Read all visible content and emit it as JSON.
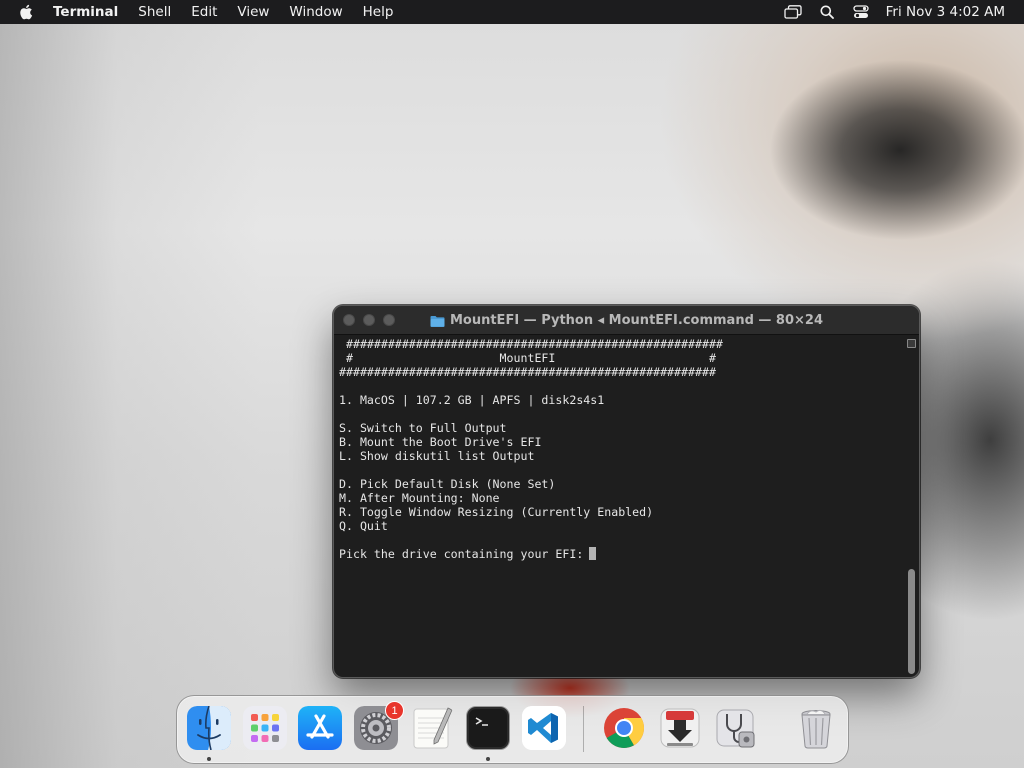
{
  "menubar": {
    "app_name": "Terminal",
    "items": [
      "Shell",
      "Edit",
      "View",
      "Window",
      "Help"
    ],
    "clock": "Fri Nov 3  4:02 AM",
    "status_icons": [
      "screen-mirroring-icon",
      "search-icon",
      "control-center-icon"
    ]
  },
  "terminal": {
    "title": "MountEFI — Python ◂ MountEFI.command — 80×24",
    "lines": [
      " ######################################################",
      " #                     MountEFI                      #",
      "######################################################",
      "",
      "1. MacOS | 107.2 GB | APFS | disk2s4s1",
      "",
      "S. Switch to Full Output",
      "B. Mount the Boot Drive's EFI",
      "L. Show diskutil list Output",
      "",
      "D. Pick Default Disk (None Set)",
      "M. After Mounting: None",
      "R. Toggle Window Resizing (Currently Enabled)",
      "Q. Quit",
      ""
    ],
    "prompt": "Pick the drive containing your EFI:"
  },
  "dock": {
    "apps": [
      {
        "name": "finder",
        "running": true
      },
      {
        "name": "launchpad",
        "running": false
      },
      {
        "name": "app-store",
        "running": false
      },
      {
        "name": "system-settings",
        "running": false,
        "badge": "1"
      },
      {
        "name": "textedit",
        "running": false
      },
      {
        "name": "terminal",
        "running": true
      },
      {
        "name": "visual-studio-code",
        "running": false
      },
      {
        "name": "google-chrome",
        "running": false
      },
      {
        "name": "installer-download",
        "running": false
      },
      {
        "name": "disk-utility",
        "running": false
      },
      {
        "name": "trash",
        "running": false
      }
    ]
  },
  "colors": {
    "menubar_bg": "#1c1c1e",
    "terminal_bg": "#1e1e1e",
    "terminal_text": "#e6e6e6",
    "badge": "#e8352c"
  }
}
